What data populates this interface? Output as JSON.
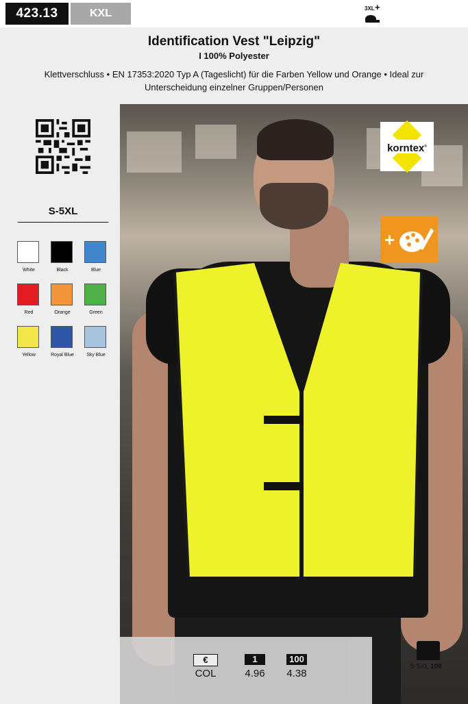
{
  "header": {
    "article_number": "423.13",
    "brand_tag": "KXL",
    "size_icon_label": "3XL",
    "size_icon_plus": "+",
    "title": "Identification Vest \"Leipzig\"",
    "subtitle": "I 100% Polyester",
    "description": "Klettverschluss • EN 17353:2020 Typ A (Tageslicht) für die Farben Yellow und Orange • Ideal zur Unterscheidung einzelner Gruppen/Personen"
  },
  "sidebar": {
    "size_range": "S-5XL",
    "colors": [
      {
        "name": "White",
        "hex": "#ffffff"
      },
      {
        "name": "Black",
        "hex": "#000000"
      },
      {
        "name": "Blue",
        "hex": "#3f86cc"
      },
      {
        "name": "Red",
        "hex": "#e31b23"
      },
      {
        "name": "Orange",
        "hex": "#f2943a"
      },
      {
        "name": "Green",
        "hex": "#4fb048"
      },
      {
        "name": "Yellow",
        "hex": "#f3e64a"
      },
      {
        "name": "Royal Blue",
        "hex": "#2f56a6"
      },
      {
        "name": "Sky Blue",
        "hex": "#a7c3de"
      }
    ]
  },
  "badges": {
    "brand_logo": "korntex",
    "custom_icon": "palette-plus-icon"
  },
  "pricing": {
    "col_label": "COL",
    "currency_symbol": "€",
    "qty1_label": "1",
    "qty1_price": "4.96",
    "qty100_label": "100",
    "qty100_price": "4.38"
  },
  "packaging": {
    "sizes": "S-5XL",
    "quantity": "100"
  }
}
